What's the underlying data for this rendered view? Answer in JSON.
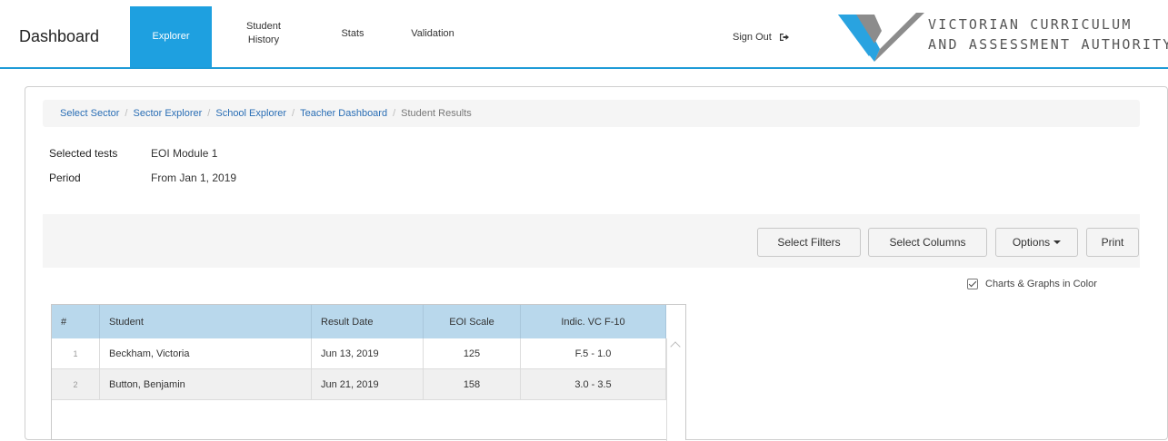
{
  "nav": {
    "brand": "Dashboard",
    "items": [
      {
        "label": "Explorer"
      },
      {
        "label": "Student\nHistory"
      },
      {
        "label": "Stats"
      },
      {
        "label": "Validation"
      }
    ],
    "sign_out": "Sign Out",
    "sign_out_icon": "sign-out-icon",
    "accent": "#1ea0e0"
  },
  "logo": {
    "line1": "VICTORIAN CURRICULUM",
    "line2": "AND ASSESSMENT AUTHORITY"
  },
  "breadcrumb": {
    "items": [
      "Select Sector",
      "Sector Explorer",
      "School Explorer",
      "Teacher Dashboard"
    ],
    "current": "Student Results"
  },
  "meta": {
    "tests_label": "Selected tests",
    "tests_value": "EOI Module 1",
    "period_label": "Period",
    "period_value": "From Jan 1, 2019"
  },
  "toolbar": {
    "filters": "Select Filters",
    "columns": "Select Columns",
    "options": "Options",
    "print": "Print"
  },
  "color_toggle": {
    "label": "Charts & Graphs in Color",
    "checked": true
  },
  "table": {
    "headers": [
      "#",
      "Student",
      "Result Date",
      "EOI Scale",
      "Indic. VC F-10"
    ],
    "rows": [
      [
        "1",
        "Beckham, Victoria",
        "Jun 13, 2019",
        "125",
        "F.5 - 1.0"
      ],
      [
        "2",
        "Button, Benjamin",
        "Jun 21, 2019",
        "158",
        "3.0 - 3.5"
      ]
    ]
  }
}
